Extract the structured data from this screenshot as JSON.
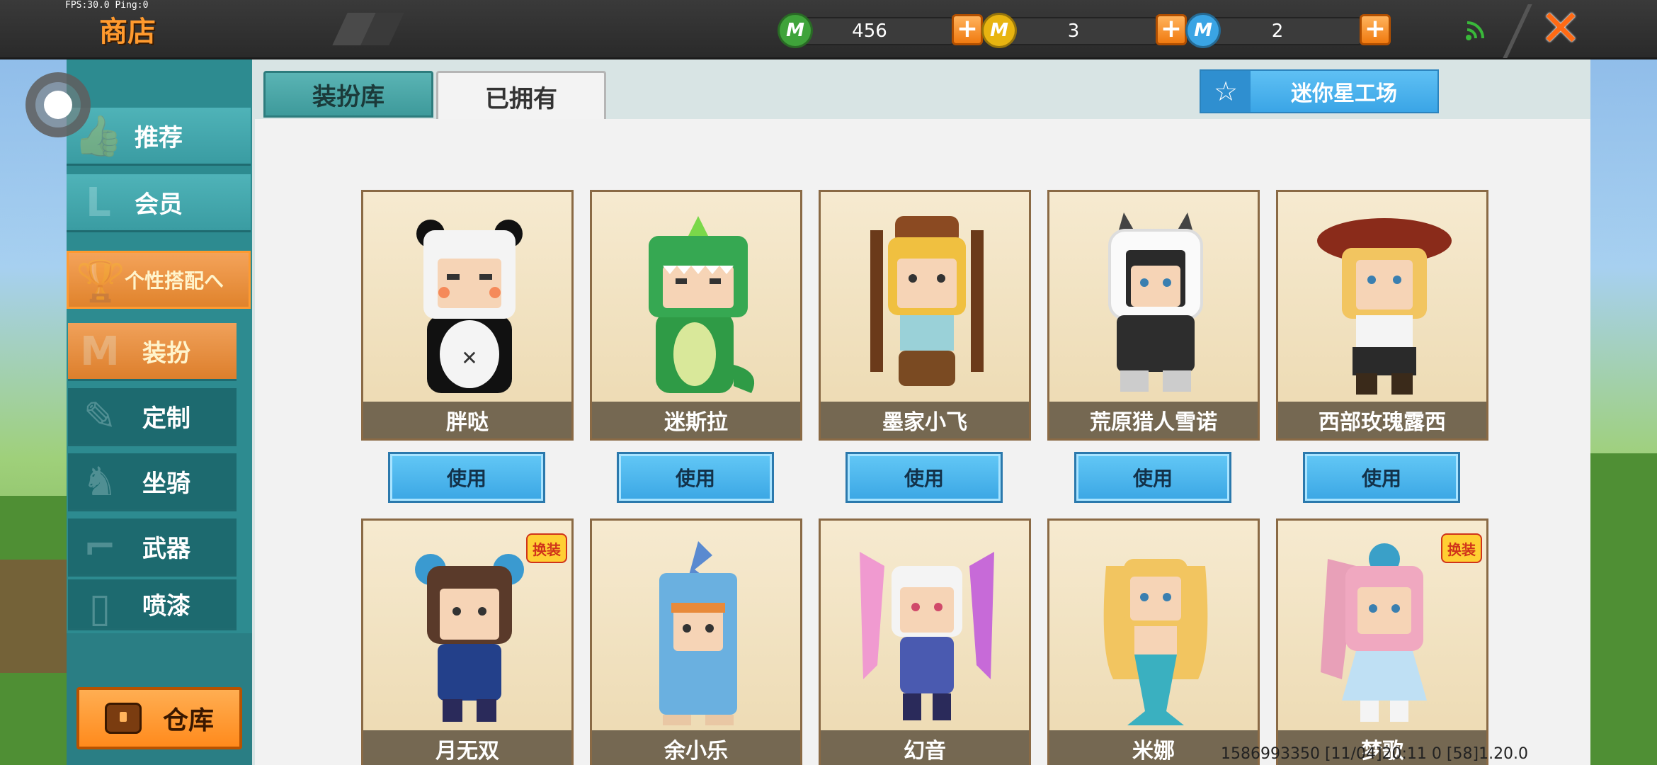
{
  "status": {
    "fps_text": "FPS:30.0  Ping:0"
  },
  "header": {
    "title": "商店"
  },
  "currencies": [
    {
      "icon": "mini-bean-coin-icon",
      "glyph": "M",
      "color": "#3fa33a",
      "value": "456"
    },
    {
      "icon": "mini-gold-coin-icon",
      "glyph": "M",
      "color": "#e8b410",
      "value": "3"
    },
    {
      "icon": "mini-star-coin-icon",
      "glyph": "M",
      "color": "#3aa4e4",
      "value": "2"
    }
  ],
  "close_glyph": "✕",
  "sidebar": {
    "items": [
      {
        "label": "推荐",
        "icon": "thumbs-up-icon"
      },
      {
        "label": "会员",
        "icon": "vip-icon"
      },
      {
        "label": "个性搭配へ",
        "icon": "trophy-icon"
      },
      {
        "label": "装扮",
        "icon": "shirt-icon"
      },
      {
        "label": "定制",
        "icon": "brush-icon"
      },
      {
        "label": "坐骑",
        "icon": "mount-icon"
      },
      {
        "label": "武器",
        "icon": "gun-icon"
      },
      {
        "label": "喷漆",
        "icon": "spray-can-icon"
      }
    ],
    "warehouse_label": "仓库"
  },
  "tabs": [
    {
      "label": "装扮库"
    },
    {
      "label": "已拥有"
    }
  ],
  "workshop_label": "迷你星工场",
  "use_label": "使用",
  "skins": [
    {
      "name": "胖哒"
    },
    {
      "name": "迷斯拉"
    },
    {
      "name": "墨家小飞"
    },
    {
      "name": "荒原猎人雪诺"
    },
    {
      "name": "西部玫瑰露西"
    },
    {
      "name": "月无双",
      "badge": "换装"
    },
    {
      "name": "余小乐"
    },
    {
      "name": "幻音"
    },
    {
      "name": "米娜"
    },
    {
      "name": "梦歌",
      "badge": "换装"
    }
  ],
  "footer": {
    "text": "1586993350  [11/04]20:11 0    [58]1.20.0"
  }
}
